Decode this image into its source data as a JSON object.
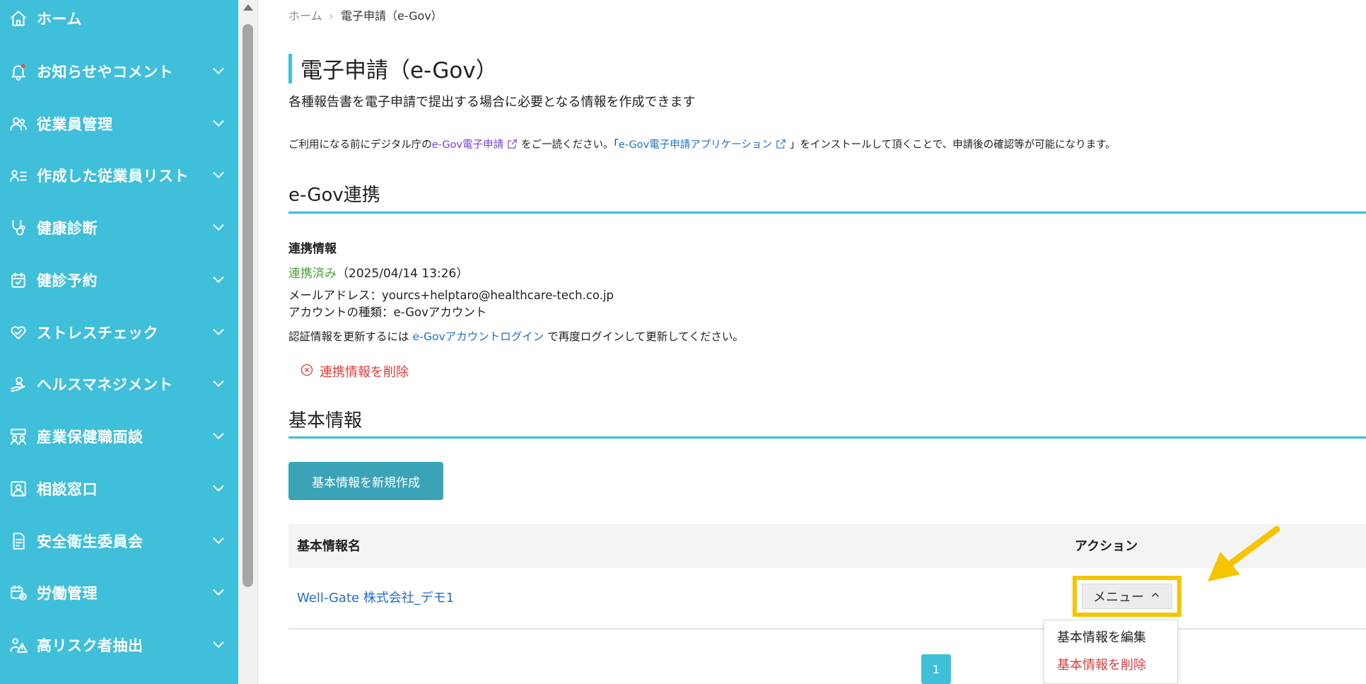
{
  "sidebar": {
    "items": [
      {
        "label": "ホーム",
        "icon": "home-icon"
      },
      {
        "label": "お知らせやコメント",
        "icon": "bell-icon"
      },
      {
        "label": "従業員管理",
        "icon": "users-icon"
      },
      {
        "label": "作成した従業員リスト",
        "icon": "user-list-icon"
      },
      {
        "label": "健康診断",
        "icon": "stethoscope-icon"
      },
      {
        "label": "健診予約",
        "icon": "calendar-check-icon"
      },
      {
        "label": "ストレスチェック",
        "icon": "heart-icon"
      },
      {
        "label": "ヘルスマネジメント",
        "icon": "health-hand-icon"
      },
      {
        "label": "産業保健職面談",
        "icon": "interview-icon"
      },
      {
        "label": "相談窓口",
        "icon": "consult-icon"
      },
      {
        "label": "安全衛生委員会",
        "icon": "document-icon"
      },
      {
        "label": "労働管理",
        "icon": "calendar-clock-icon"
      },
      {
        "label": "高リスク者抽出",
        "icon": "alert-person-icon"
      }
    ]
  },
  "breadcrumb": {
    "home": "ホーム",
    "separator": "›",
    "current": "電子申請（e-Gov）"
  },
  "page": {
    "title": "電子申請（e-Gov）",
    "subtitle": "各種報告書を電子申請で提出する場合に必要となる情報を作成できます",
    "notice": {
      "pre": "ご利用になる前にデジタル庁の",
      "link1": "e-Gov電子申請",
      "mid": "をご一読ください。「",
      "link2": "e-Gov電子申請アプリケーション",
      "post": "」をインストールして頂くことで、申請後の確認等が可能になります。"
    }
  },
  "egov": {
    "section_title": "e-Gov連携",
    "info_label": "連携情報",
    "status": "連携済み",
    "status_date": "（2025/04/14 13:26）",
    "email_line": "メールアドレス：yourcs+helptaro@healthcare-tech.co.jp",
    "account_line": "アカウントの種類：e-Govアカウント",
    "renew_pre": "認証情報を更新するには ",
    "renew_link": "e-Govアカウントログイン",
    "renew_post": " で再度ログインして更新してください。",
    "delete_link": "連携情報を削除"
  },
  "basic": {
    "section_title": "基本情報",
    "create_button": "基本情報を新規作成",
    "table": {
      "headers": [
        "基本情報名",
        "アクション"
      ],
      "rows": [
        {
          "name": "Well-Gate 株式会社_デモ1",
          "action": "メニュー"
        }
      ]
    },
    "dropdown": {
      "edit": "基本情報を編集",
      "delete": "基本情報を削除"
    },
    "pagination": {
      "current": "1"
    }
  },
  "colors": {
    "sidebar": "#3fbfda",
    "accent": "#3fbfda",
    "button": "#3aa3b8",
    "link": "#1f6fd1",
    "danger": "#e23b3b",
    "success": "#4aa53a",
    "highlight": "#f6c400"
  }
}
